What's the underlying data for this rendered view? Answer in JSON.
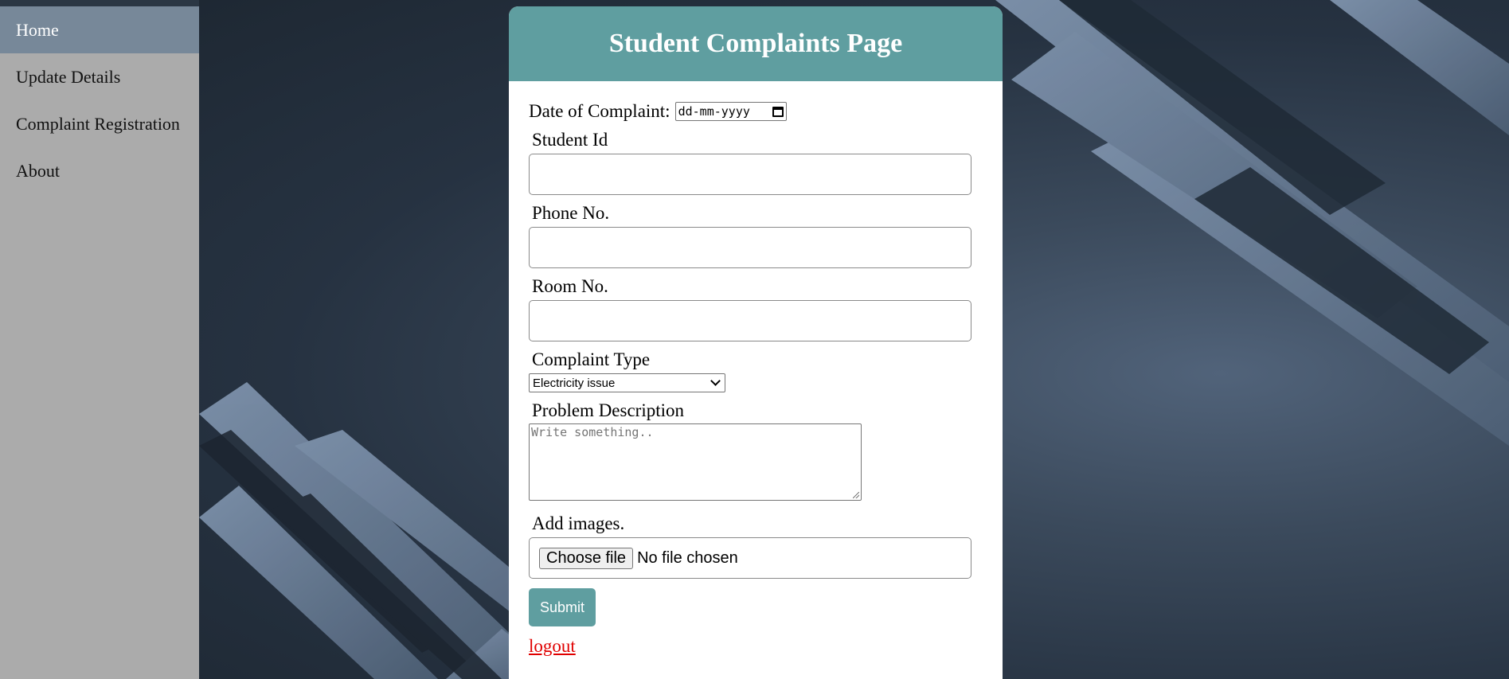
{
  "sidebar": {
    "items": [
      {
        "label": "Home",
        "active": true
      },
      {
        "label": "Update Details"
      },
      {
        "label": "Complaint Registration"
      },
      {
        "label": "About"
      }
    ]
  },
  "form": {
    "title": "Student Complaints Page",
    "date_label": "Date of Complaint:",
    "date_placeholder": "dd-mm-yyyy",
    "student_id_label": "Student Id",
    "phone_label": "Phone No.",
    "room_label": "Room No.",
    "complaint_type_label": "Complaint Type",
    "complaint_type_value": "Electricity issue",
    "description_label": "Problem Description",
    "description_placeholder": "Write something..",
    "images_label": "Add images.",
    "file_button_label": "Choose file",
    "file_status": "No file chosen",
    "submit_label": "Submit",
    "logout_label": "logout"
  },
  "colors": {
    "accent": "#5f9ea0",
    "sidebar_bg": "#ababab",
    "sidebar_active": "#778899",
    "logout_link": "#e00000"
  }
}
